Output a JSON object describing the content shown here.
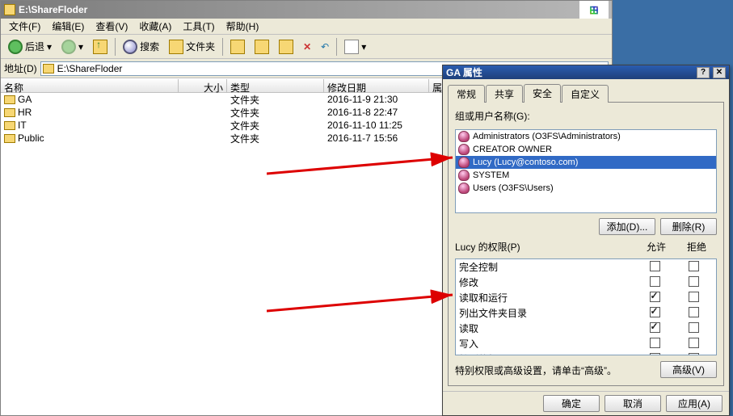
{
  "explorer": {
    "title": "E:\\ShareFloder",
    "menu": [
      "文件(F)",
      "编辑(E)",
      "查看(V)",
      "收藏(A)",
      "工具(T)",
      "帮助(H)"
    ],
    "toolbar": {
      "back": "后退",
      "search": "搜索",
      "folders": "文件夹"
    },
    "address": {
      "label": "地址(D)",
      "value": "E:\\ShareFloder"
    },
    "cols": {
      "name": "名称",
      "size": "大小",
      "type": "类型",
      "date": "修改日期",
      "attr": "属性"
    },
    "rows": [
      {
        "name": "GA",
        "type": "文件夹",
        "date": "2016-11-9 21:30"
      },
      {
        "name": "HR",
        "type": "文件夹",
        "date": "2016-11-8 22:47"
      },
      {
        "name": "IT",
        "type": "文件夹",
        "date": "2016-11-10 11:25"
      },
      {
        "name": "Public",
        "type": "文件夹",
        "date": "2016-11-7 15:56"
      }
    ]
  },
  "dlg": {
    "title": "GA 属性",
    "tabs": [
      "常规",
      "共享",
      "安全",
      "自定义"
    ],
    "active_tab": "安全",
    "users_label": "组或用户名称(G):",
    "users": [
      {
        "text": "Administrators (O3FS\\Administrators)",
        "sel": false
      },
      {
        "text": "CREATOR OWNER",
        "sel": false
      },
      {
        "text": "Lucy (Lucy@contoso.com)",
        "sel": true
      },
      {
        "text": "SYSTEM",
        "sel": false
      },
      {
        "text": "Users (O3FS\\Users)",
        "sel": false
      }
    ],
    "btn_add": "添加(D)...",
    "btn_remove": "删除(R)",
    "perm_label": "Lucy 的权限(P)",
    "col_allow": "允许",
    "col_deny": "拒绝",
    "perms": [
      {
        "n": "完全控制",
        "a": false,
        "d": false
      },
      {
        "n": "修改",
        "a": false,
        "d": false
      },
      {
        "n": "读取和运行",
        "a": true,
        "d": false
      },
      {
        "n": "列出文件夹目录",
        "a": true,
        "d": false
      },
      {
        "n": "读取",
        "a": true,
        "d": false
      },
      {
        "n": "写入",
        "a": false,
        "d": false
      },
      {
        "n": "特别的权限",
        "a": false,
        "d": false
      }
    ],
    "note": "特别权限或高级设置，请单击“高级”。",
    "btn_adv": "高级(V)",
    "btn_ok": "确定",
    "btn_cancel": "取消",
    "btn_apply": "应用(A)"
  }
}
